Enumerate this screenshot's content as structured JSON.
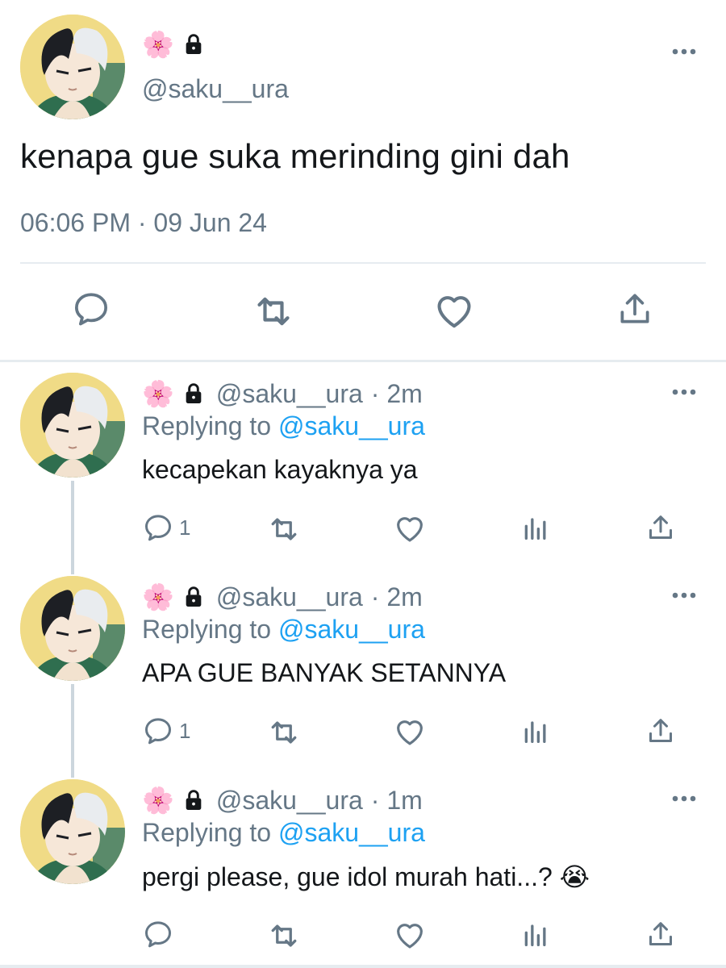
{
  "main_tweet": {
    "flower_emoji": "🌸",
    "handle": "@saku__ura",
    "text": "kenapa gue suka merinding gini dah",
    "time": "06:06 PM · 09 Jun 24"
  },
  "replies": [
    {
      "flower_emoji": "🌸",
      "handle": "@saku__ura",
      "time": "· 2m",
      "replying_prefix": "Replying to ",
      "replying_to": "@saku__ura",
      "text": "kecapekan kayaknya ya",
      "reply_count": "1"
    },
    {
      "flower_emoji": "🌸",
      "handle": "@saku__ura",
      "time": "· 2m",
      "replying_prefix": "Replying to ",
      "replying_to": "@saku__ura",
      "text": "APA GUE BANYAK SETANNYA",
      "reply_count": "1"
    },
    {
      "flower_emoji": "🌸",
      "handle": "@saku__ura",
      "time": "· 1m",
      "replying_prefix": "Replying to ",
      "replying_to": "@saku__ura",
      "text": "pergi please, gue idol murah hati...?",
      "emoji": "😭",
      "reply_count": ""
    }
  ],
  "icons": {
    "reply": "reply-icon",
    "retweet": "retweet-icon",
    "like": "heart-icon",
    "share": "share-icon",
    "analytics": "analytics-icon",
    "more": "more-icon",
    "lock": "lock-icon"
  },
  "colors": {
    "accent": "#1da1f2",
    "secondary_text": "#657786",
    "icon": "#657786",
    "divider": "#e6ecf0"
  }
}
